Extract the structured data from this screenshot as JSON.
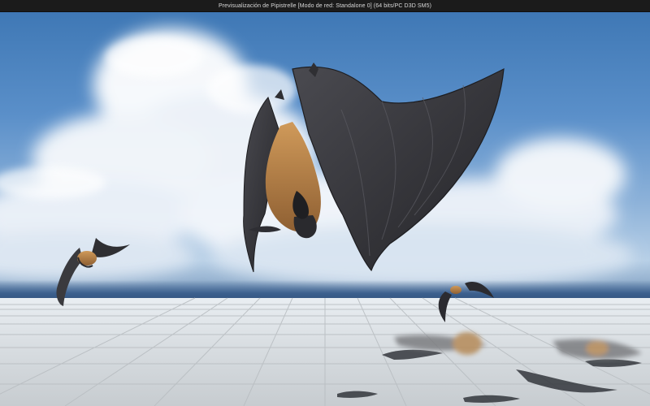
{
  "window": {
    "title": "Previsualización de Pipistrelle [Modo de red: Standalone 0]  (64 bits/PC D3D SM5)"
  },
  "viewport": {
    "scene": {
      "subject": "bats-in-flight",
      "environment": "sky-and-tiled-floor"
    }
  },
  "colors": {
    "titlebar_bg": "#1b1b1b",
    "titlebar_text": "#d9d9d9",
    "sky_top": "#3f78b5",
    "floor": "#d8dde1",
    "wing": "#3a3a3e",
    "fur": "#b9874e"
  }
}
